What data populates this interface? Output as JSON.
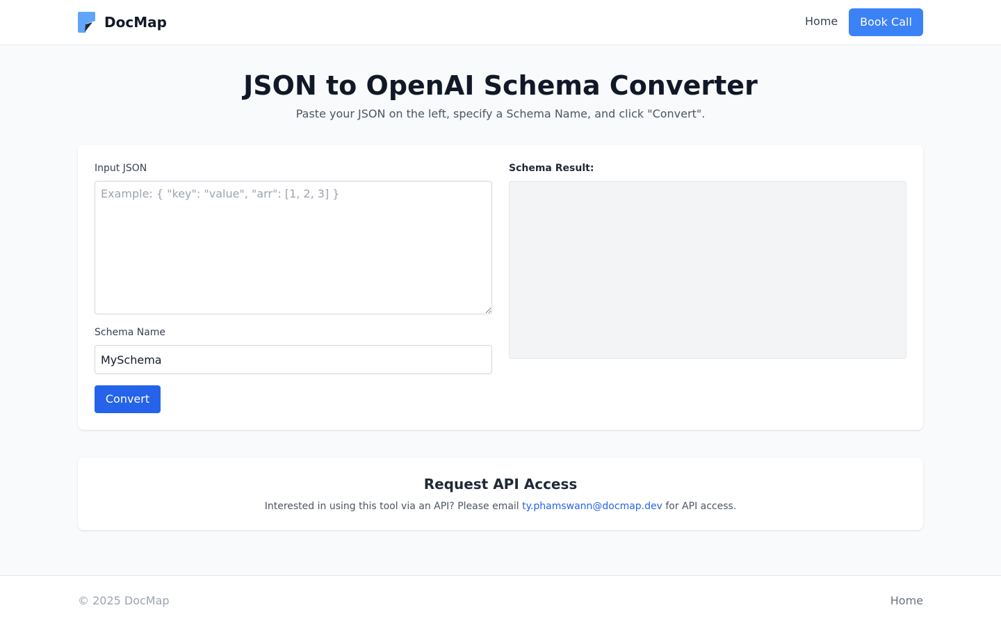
{
  "header": {
    "brand_name": "DocMap",
    "logo_icon": "docmap-logo-icon",
    "nav": {
      "home_label": "Home",
      "book_call_label": "Book Call"
    }
  },
  "main": {
    "title": "JSON to OpenAI Schema Converter",
    "subtitle": "Paste your JSON on the left, specify a Schema Name, and click \"Convert\"."
  },
  "converter": {
    "input_label": "Input JSON",
    "input_value": "",
    "input_placeholder": "Example: { \"key\": \"value\", \"arr\": [1, 2, 3] }",
    "schema_name_label": "Schema Name",
    "schema_name_value": "MySchema",
    "convert_label": "Convert",
    "result_label": "Schema Result:",
    "result_value": ""
  },
  "api_access": {
    "title": "Request API Access",
    "text_before": "Interested in using this tool via an API? Please email ",
    "email": "ty.phamswann@docmap.dev",
    "text_after": " for API access."
  },
  "footer": {
    "copyright": "© 2025 DocMap",
    "home_label": "Home"
  },
  "colors": {
    "primary": "#2563eb",
    "book_call": "#3b82f6",
    "page_background": "#f9fafb",
    "heading": "#111827",
    "muted_text": "#4b5563",
    "result_panel": "#f3f4f6",
    "logo_light": "#60a5fa",
    "logo_dark": "#1f2937"
  }
}
